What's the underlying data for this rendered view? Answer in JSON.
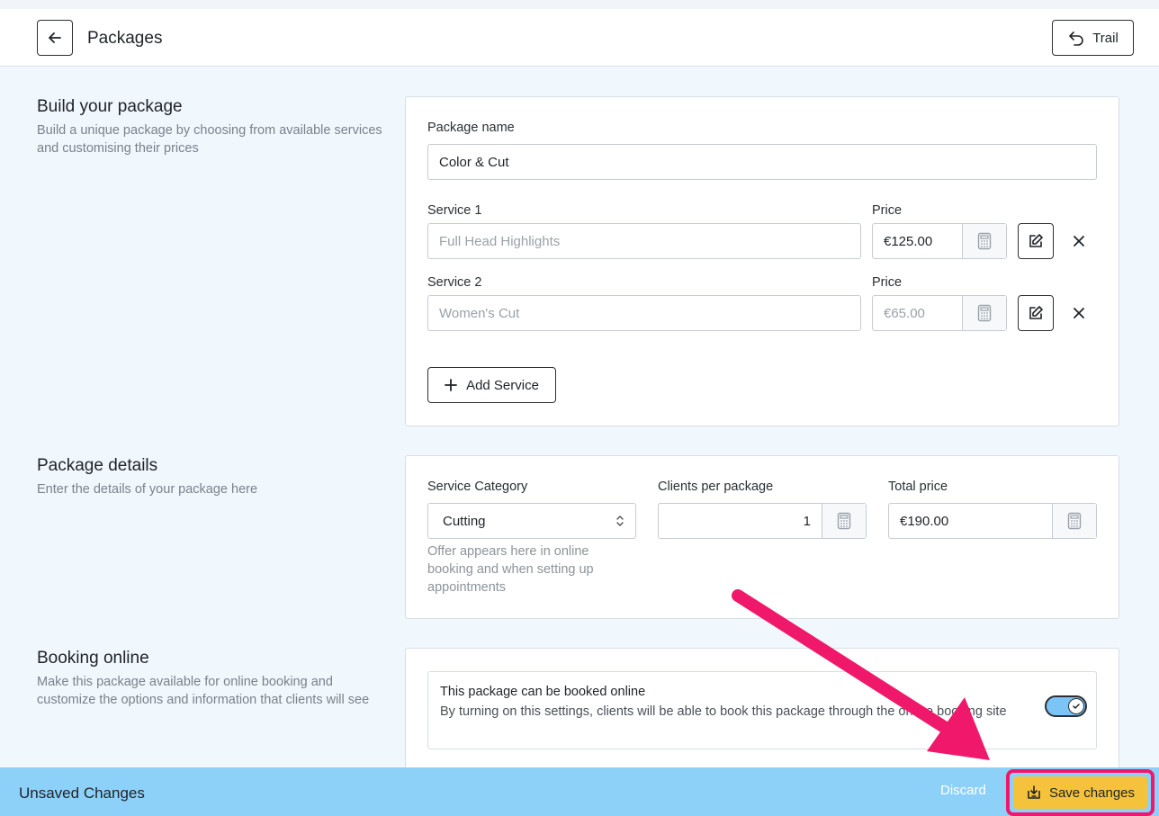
{
  "header": {
    "title": "Packages",
    "trail_label": "Trail"
  },
  "build": {
    "title": "Build your package",
    "description": "Build a unique package by choosing from available services and customising their prices",
    "package_name_label": "Package name",
    "package_name_value": "Color & Cut",
    "services": [
      {
        "label": "Service 1",
        "placeholder": "Full Head Highlights",
        "price_label": "Price",
        "price": "€125.00"
      },
      {
        "label": "Service 2",
        "placeholder": "Women's Cut",
        "price_label": "Price",
        "price": "€65.00"
      }
    ],
    "add_service_label": "Add Service"
  },
  "details": {
    "title": "Package details",
    "description": "Enter the details of your package here",
    "category_label": "Service Category",
    "category_value": "Cutting",
    "category_hint": "Offer appears here in online booking and when setting up appointments",
    "clients_label": "Clients per package",
    "clients_value": "1",
    "total_label": "Total price",
    "total_value": "€190.00"
  },
  "online": {
    "title": "Booking online",
    "description": "Make this package available for online booking and customize the options and information that clients will see",
    "toggle_title": "This package can be booked online",
    "toggle_desc": "By turning on this settings, clients will be able to book this package through the online booking site",
    "enabled": true
  },
  "footer": {
    "status": "Unsaved Changes",
    "discard_label": "Discard",
    "save_label": "Save changes"
  },
  "colors": {
    "accent": "#8dd1f9",
    "save": "#f4c23b",
    "highlight": "#f0186a"
  },
  "icons": [
    "back-arrow-icon",
    "undo-icon",
    "calculator-icon",
    "edit-icon",
    "close-icon",
    "plus-icon",
    "chevron-updown-icon",
    "check-icon",
    "save-icon"
  ]
}
